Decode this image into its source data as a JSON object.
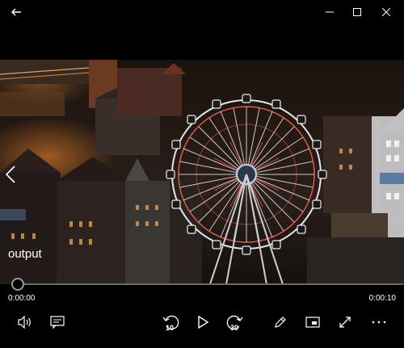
{
  "window": {
    "back_icon": "arrow-left-icon",
    "minimize_icon": "minimize-icon",
    "maximize_icon": "maximize-icon",
    "close_icon": "close-icon"
  },
  "video": {
    "title": "output",
    "scene": "night-ferris-wheel-city"
  },
  "player": {
    "current_time": "0:00:00",
    "total_time": "0:00:10",
    "progress_fraction": 0,
    "skip_back_label": "10",
    "skip_forward_label": "30",
    "controls": {
      "volume_icon": "volume-icon",
      "captions_icon": "captions-icon",
      "skip_back_icon": "skip-back-icon",
      "play_icon": "play-icon",
      "skip_forward_icon": "skip-forward-icon",
      "edit_icon": "pencil-icon",
      "mini_view_icon": "mini-view-icon",
      "fullscreen_icon": "fullscreen-icon",
      "more_icon": "more-options-icon"
    }
  }
}
